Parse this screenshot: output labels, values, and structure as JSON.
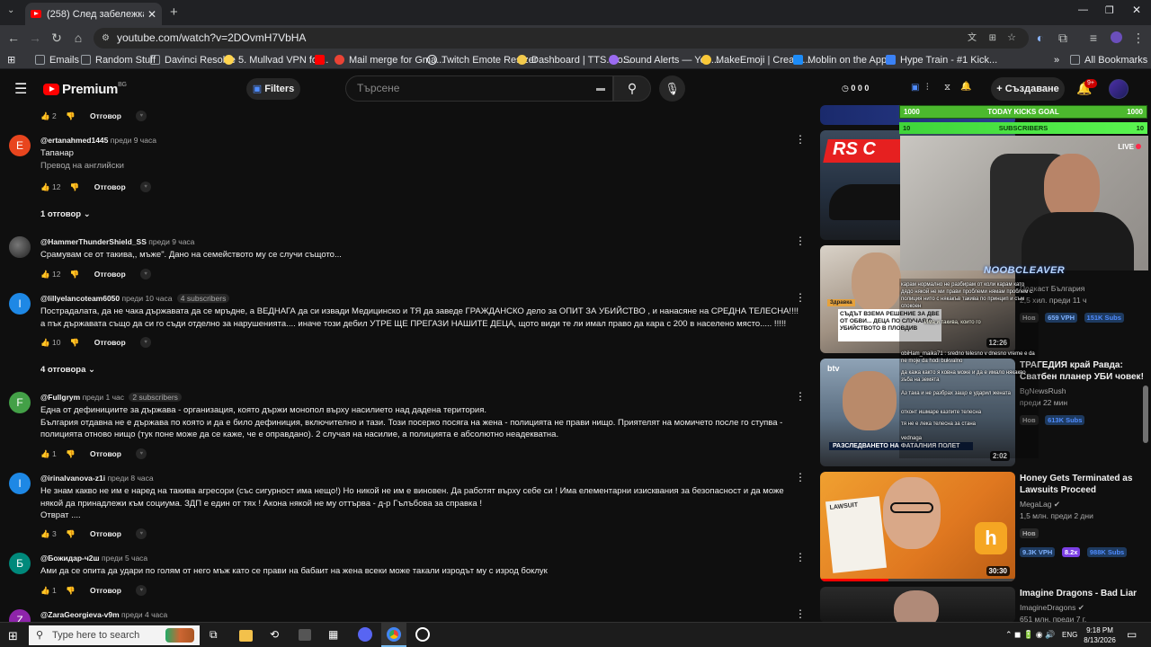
{
  "browser": {
    "tab_title": "(258) След забележка: Жена бе...",
    "url": "youtube.com/watch?v=2DOvmH7VbHA",
    "bookmarks": [
      {
        "label": "Emails",
        "color": "#9aa0a6"
      },
      {
        "label": "Random Stuff",
        "color": "#9aa0a6"
      },
      {
        "label": "Davinci Resolve",
        "color": "#9aa0a6"
      },
      {
        "label": "5. Mullvad VPN for...",
        "color": "#ffd44f"
      },
      {
        "label": "",
        "color": "#ff0000"
      },
      {
        "label": "Mail merge for Gma...",
        "color": "#ea4335"
      },
      {
        "label": "Twitch Emote Resizer",
        "color": "#e8eaed"
      },
      {
        "label": "Dashboard | TTS.Mo...",
        "color": "#f2c94c"
      },
      {
        "label": "Sound Alerts — You...",
        "color": "#9b6bf2"
      },
      {
        "label": "MakeEmoji | Create...",
        "color": "#f9c838"
      },
      {
        "label": "Moblin on the App...",
        "color": "#1d8cf8"
      },
      {
        "label": "Hype Train - #1 Kick...",
        "color": "#3b82f6"
      }
    ],
    "all_bookmarks": "All Bookmarks"
  },
  "header": {
    "logo": "Premium",
    "logo_region": "BG",
    "filters": "Filters",
    "search_placeholder": "Търсене",
    "stats": "0  0  0",
    "create": "Създаване",
    "notif_count": "9+"
  },
  "comments": {
    "top_likes": "2",
    "reply_label": "Отговор",
    "items": [
      {
        "letter": "E",
        "color": "#e8451e",
        "author": "@ertanahmed1445",
        "time": "преди 9 часа",
        "badge": "",
        "text": "Тапанар",
        "sub": "Превод на английски",
        "likes": "12",
        "replies": "1 отговор"
      },
      {
        "letter": "",
        "color": "#555",
        "author": "@HammerThunderShield_SS",
        "time": "преди 9 часа",
        "badge": "",
        "text": "Срамувам се от такива,, мъже\". Дано на семейството му се случи същото...",
        "sub": "",
        "likes": "12",
        "replies": ""
      },
      {
        "letter": "I",
        "color": "#1e88e5",
        "author": "@lillyelancoteam6050",
        "time": "преди 10 часа",
        "badge": "4 subscribers",
        "text": "Пострадалата, да не чака държавата да се мръдне, а ВЕДНАГА да си извади Медицинско и ТЯ да заведе  ГРАЖДАНСКО дело за ОПИТ ЗА УБИЙСТВО , и нанасяне на СРЕДНА ТЕЛЕСНА!!!! а пък държавата също да си го съди отделно за нарушенията.... иначе този дебил УТРЕ ЩЕ ПРЕГАЗИ НАШИТЕ ДЕЦА, щото види те ли имал право да кара с 200 в населено място..... !!!!!",
        "sub": "",
        "likes": "10",
        "replies": "4 отговора"
      },
      {
        "letter": "F",
        "color": "#43a047",
        "author": "@Fullgrym",
        "time": "преди 1 час",
        "badge": "2 subscribers",
        "text": "Една от дефинициите за държава - организация, която държи монопол върху насилието над дадена територия.\nБългария отдавна не е държава по която и да е било дефиниция, включително и тази. Този посерко посяга на жена - полицията не прави нищо. Приятелят на момичето после го ступва - полицията отново нищо (тук поне може да се каже, че е оправдано). 2 случая на насилие, а полицията е абсолютно неадекватна.",
        "sub": "",
        "likes": "1",
        "replies": ""
      },
      {
        "letter": "I",
        "color": "#1e88e5",
        "author": "@irinalvanova-z1i",
        "time": "преди 8 часа",
        "badge": "",
        "text": "Не знам какво не им е наред на такива агресори (със сигурност има нещо!) Но никой не им е виновен. Да работят върху себе си ! Има елементарни изисквания за безопасност и да може някой да принадлежи към социума. ЗДП е един от тях ! Акона някой не му оттърва - д-р Гълъбова за справка !\nОтврат ....",
        "sub": "",
        "likes": "3",
        "replies": ""
      },
      {
        "letter": "Б",
        "color": "#00897b",
        "author": "@Божидар-ч2ш",
        "time": "преди 5 часа",
        "badge": "",
        "text": "Ами да се опита да удари по голям от него мъж като се прави на бабаит  на жена всеки може такали  изродът му с изрод боклук",
        "sub": "",
        "likes": "1",
        "replies": ""
      },
      {
        "letter": "Z",
        "color": "#8e24aa",
        "author": "@ZaraGeorgieva-v9m",
        "time": "преди 4 часа",
        "badge": "",
        "text": "",
        "sub": "",
        "likes": "",
        "replies": ""
      }
    ]
  },
  "sidebar": {
    "videos": [
      {
        "title": "",
        "channel": "",
        "stats": "",
        "chips": [],
        "duration": ""
      },
      {
        "title": "",
        "channel": "Подкаст България",
        "stats": "2,5 хил.  преди 11 ч",
        "chips": [
          "Нов",
          "659 VPH",
          "151K Subs"
        ],
        "duration": "12:26"
      },
      {
        "title": "ТРАГЕДИЯ край Равда: Сватбен планер УБИ човек!",
        "channel": "BgNewsRush",
        "stats": "преди 22 мин",
        "chips": [
          "Нов",
          "613K Subs"
        ],
        "duration": "2:02"
      },
      {
        "title": "Honey Gets Terminated as Lawsuits Proceed",
        "channel": "MegaLag",
        "stats": "1,5 млн.  преди 2 дни",
        "chips": [
          "Нов",
          "9.3K VPH",
          "8.2x",
          "988K Subs"
        ],
        "duration": "30:30"
      },
      {
        "title": "Imagine Dragons - Bad Liar",
        "channel": "ImagineDragons",
        "stats": "651 млн.  преди 7 г.",
        "chips": [],
        "duration": ""
      }
    ],
    "thumb_texts": {
      "rs": "RS C",
      "v2_headline": "СЪДЪТ ВЗЕМА РЕШЕНИЕ ЗА ДВЕ ОТ ОБВИ... ДЕЦА ПО СЛУЧАЯ С... УБИЙСТВОТО В ПЛОВДИВ",
      "v2_tag": "Здравка",
      "v3_logo": "btv",
      "v3_headline": "РАЗСЛЕДВАНЕТО НА ФАТАЛНИЯ ПОЛЕТ",
      "v4_paper": "LAWSUIT"
    }
  },
  "overlay": {
    "goal_left": "1000",
    "goal_label": "TODAY KICKS GOAL",
    "goal_right": "1000",
    "subs_left": "10",
    "subs_label": "SUBSCRIBERS",
    "subs_right": "10",
    "live": "LIVE",
    "name": "NOOBCLEAVER",
    "chat": [
      "карам нормално не разбирам от коли карам като дядо някой не ми прави проблеми нямам проблем с полиция нито с някакъв такива по принцип и съм спокоен",
      "Има и такива, които го",
      "obiHam_maika71 : sredno telesno v dnesno vreme e da ne moje da hodi bukvalno",
      "да кажа както я ковна може и да е имало някакво зъба на земята",
      "Аз така и не разбрах защо е ударил жената",
      "отконт ишмаре казпите телесна",
      "тя не е лека телесна за стана",
      "vednaga"
    ]
  },
  "taskbar": {
    "search_placeholder": "Type here to search",
    "lang": "ENG",
    "time": "9:18 PM",
    "date": "8/13/2026"
  }
}
